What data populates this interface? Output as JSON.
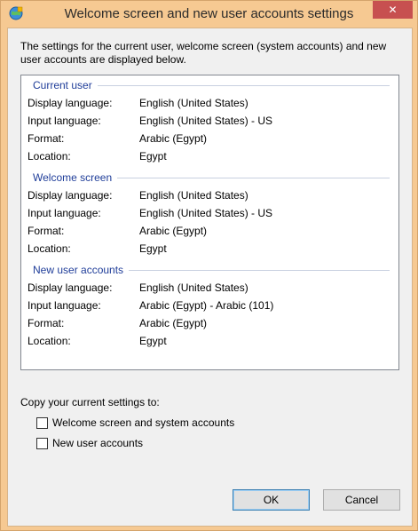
{
  "window": {
    "title": "Welcome screen and new user accounts settings",
    "close_glyph": "✕"
  },
  "intro": "The settings for the current user, welcome screen (system accounts) and new user accounts are displayed below.",
  "sections": [
    {
      "heading": "Current user",
      "rows": [
        {
          "label": "Display language:",
          "value": "English (United States)"
        },
        {
          "label": "Input language:",
          "value": "English (United States) - US"
        },
        {
          "label": "Format:",
          "value": "Arabic (Egypt)"
        },
        {
          "label": "Location:",
          "value": "Egypt"
        }
      ]
    },
    {
      "heading": "Welcome screen",
      "rows": [
        {
          "label": "Display language:",
          "value": "English (United States)"
        },
        {
          "label": "Input language:",
          "value": "English (United States) - US"
        },
        {
          "label": "Format:",
          "value": "Arabic (Egypt)"
        },
        {
          "label": "Location:",
          "value": "Egypt"
        }
      ]
    },
    {
      "heading": "New user accounts",
      "rows": [
        {
          "label": "Display language:",
          "value": "English (United States)"
        },
        {
          "label": "Input language:",
          "value": "Arabic (Egypt) - Arabic (101)"
        },
        {
          "label": "Format:",
          "value": "Arabic (Egypt)"
        },
        {
          "label": "Location:",
          "value": "Egypt"
        }
      ]
    }
  ],
  "copy": {
    "label": "Copy your current settings to:",
    "options": [
      {
        "label": "Welcome screen and system accounts",
        "checked": false
      },
      {
        "label": "New user accounts",
        "checked": false
      }
    ]
  },
  "buttons": {
    "ok": "OK",
    "cancel": "Cancel"
  }
}
